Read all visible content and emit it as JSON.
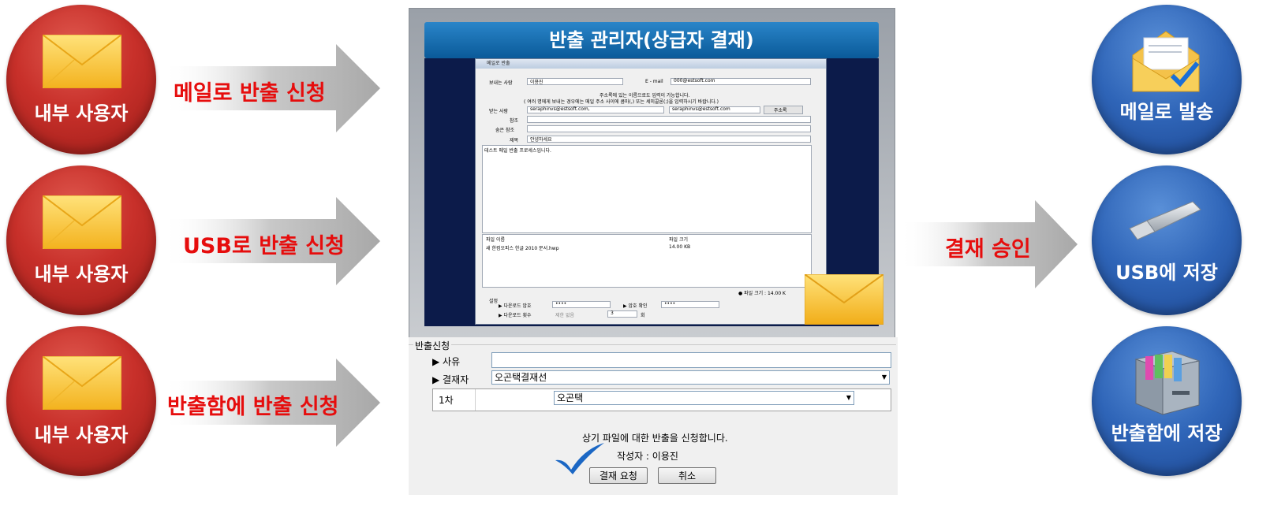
{
  "left_users": [
    {
      "label": "내부 사용자",
      "icon": "envelope-icon",
      "action": "메일로 반출 신청"
    },
    {
      "label": "내부 사용자",
      "icon": "envelope-icon",
      "action": "USB로 반출 신청"
    },
    {
      "label": "내부 사용자",
      "icon": "envelope-icon",
      "action": "반출함에 반출 신청"
    }
  ],
  "approval_label": "결재 승인",
  "right_outputs": [
    {
      "label": "메일로 발송",
      "icon": "open-mail-check-icon"
    },
    {
      "label": "USB에 저장",
      "icon": "usb-drive-icon"
    },
    {
      "label": "반출함에 저장",
      "icon": "file-cabinet-icon"
    }
  ],
  "panel": {
    "title": "반출 관리자(상급자 결재)",
    "dialog": {
      "window_title": "메일로 반출",
      "sender_label": "보내는 사람",
      "sender_value": "이용진",
      "email_label": "E - mail",
      "email_value": "000@estsoft.com",
      "notice_1": "주소록에 있는 이름으로도 입력이 가능합니다.",
      "notice_2": "( 여러 명에게 보내는 경우에는 메일 주소 사이에 콤마(,) 또는 세미콜론(;)을 입력하시기 바랍니다.)",
      "to_label": "받는 사람",
      "to_value": "seraphinvs@estsoft.com,",
      "to_select": "seraphinvs@estsoft.com",
      "addressbook_button": "주소록",
      "cc_label": "참조",
      "bcc_label": "숨은 참조",
      "subject_label": "제목",
      "subject_value": "안녕하세요",
      "body": "테스트 메일 반출 프로세스입니다.",
      "file_name_header": "파일 이름",
      "file_size_header": "파일 크기",
      "file_name": "새 한컴오피스 한글 2010 문서.hwp",
      "file_size": "14.00 KB",
      "total_size": "● 파일 크기 :     14.00 K",
      "settings_label": "설정",
      "download_pw_label": "▶ 다운로드 암호",
      "download_pw_value": "••••",
      "pw_confirm_label": "▶ 암호 확인",
      "pw_confirm_value": "••••",
      "download_count_label": "▶ 다운로드 횟수",
      "unlimited_label": "제한 없음",
      "count_value": "3",
      "count_unit": "회"
    }
  },
  "form": {
    "group_title": "반출신청",
    "reason_label": "▶ 사유",
    "approver_label": "▶ 결재자",
    "approver_select": "오곤택결재선",
    "stage_label": "1차",
    "stage_select": "오곤택",
    "message": "상기 파일에 대한 반출을 신청합니다.",
    "author": "작성자 :  이용진",
    "request_button": "결재 요청",
    "cancel_button": "취소"
  }
}
